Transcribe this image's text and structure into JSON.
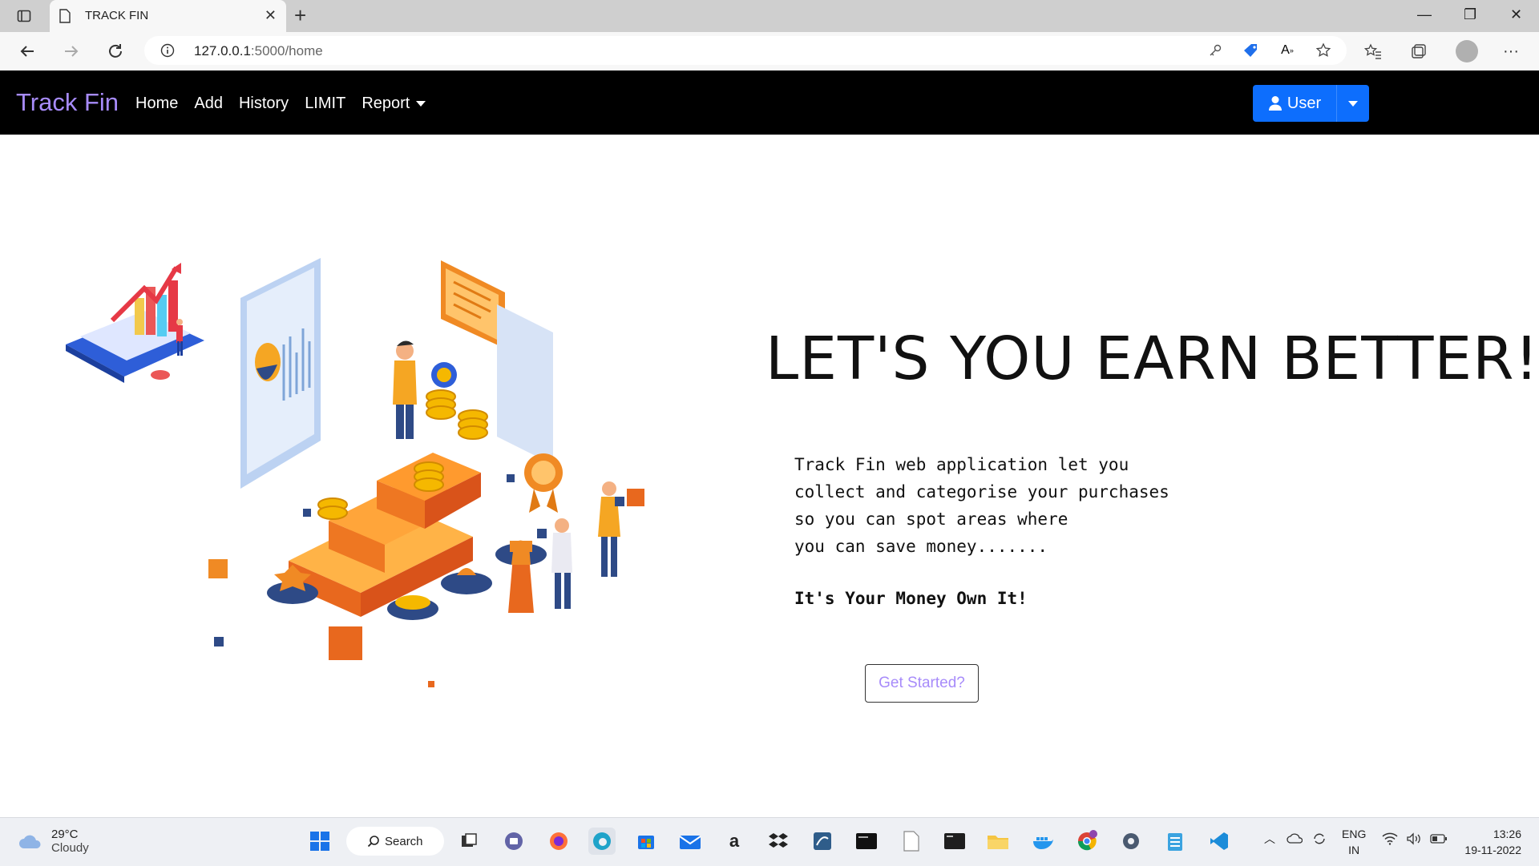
{
  "browser": {
    "tab_title": "TRACK FIN",
    "url_host": "127.0.0.1",
    "url_path": ":5000/home"
  },
  "navbar": {
    "brand": "Track Fin",
    "links": [
      "Home",
      "Add",
      "History",
      "LIMIT"
    ],
    "report_label": "Report",
    "user_label": "User"
  },
  "hero": {
    "headline": "LET'S YOU EARN BETTER!",
    "description_lines": [
      "Track Fin web application let you",
      "collect and categorise your purchases",
      "so you can spot areas where",
      "you can save money......."
    ],
    "tagline": "It's Your Money Own It!",
    "cta_label": "Get Started?"
  },
  "taskbar": {
    "temperature": "29°C",
    "weather": "Cloudy",
    "search_label": "Search",
    "lang": "ENG",
    "region": "IN",
    "time": "13:26",
    "date": "19-11-2022"
  },
  "colors": {
    "brand": "#a78bfa",
    "user_button": "#0d6efd",
    "navbar_bg": "#000000"
  }
}
